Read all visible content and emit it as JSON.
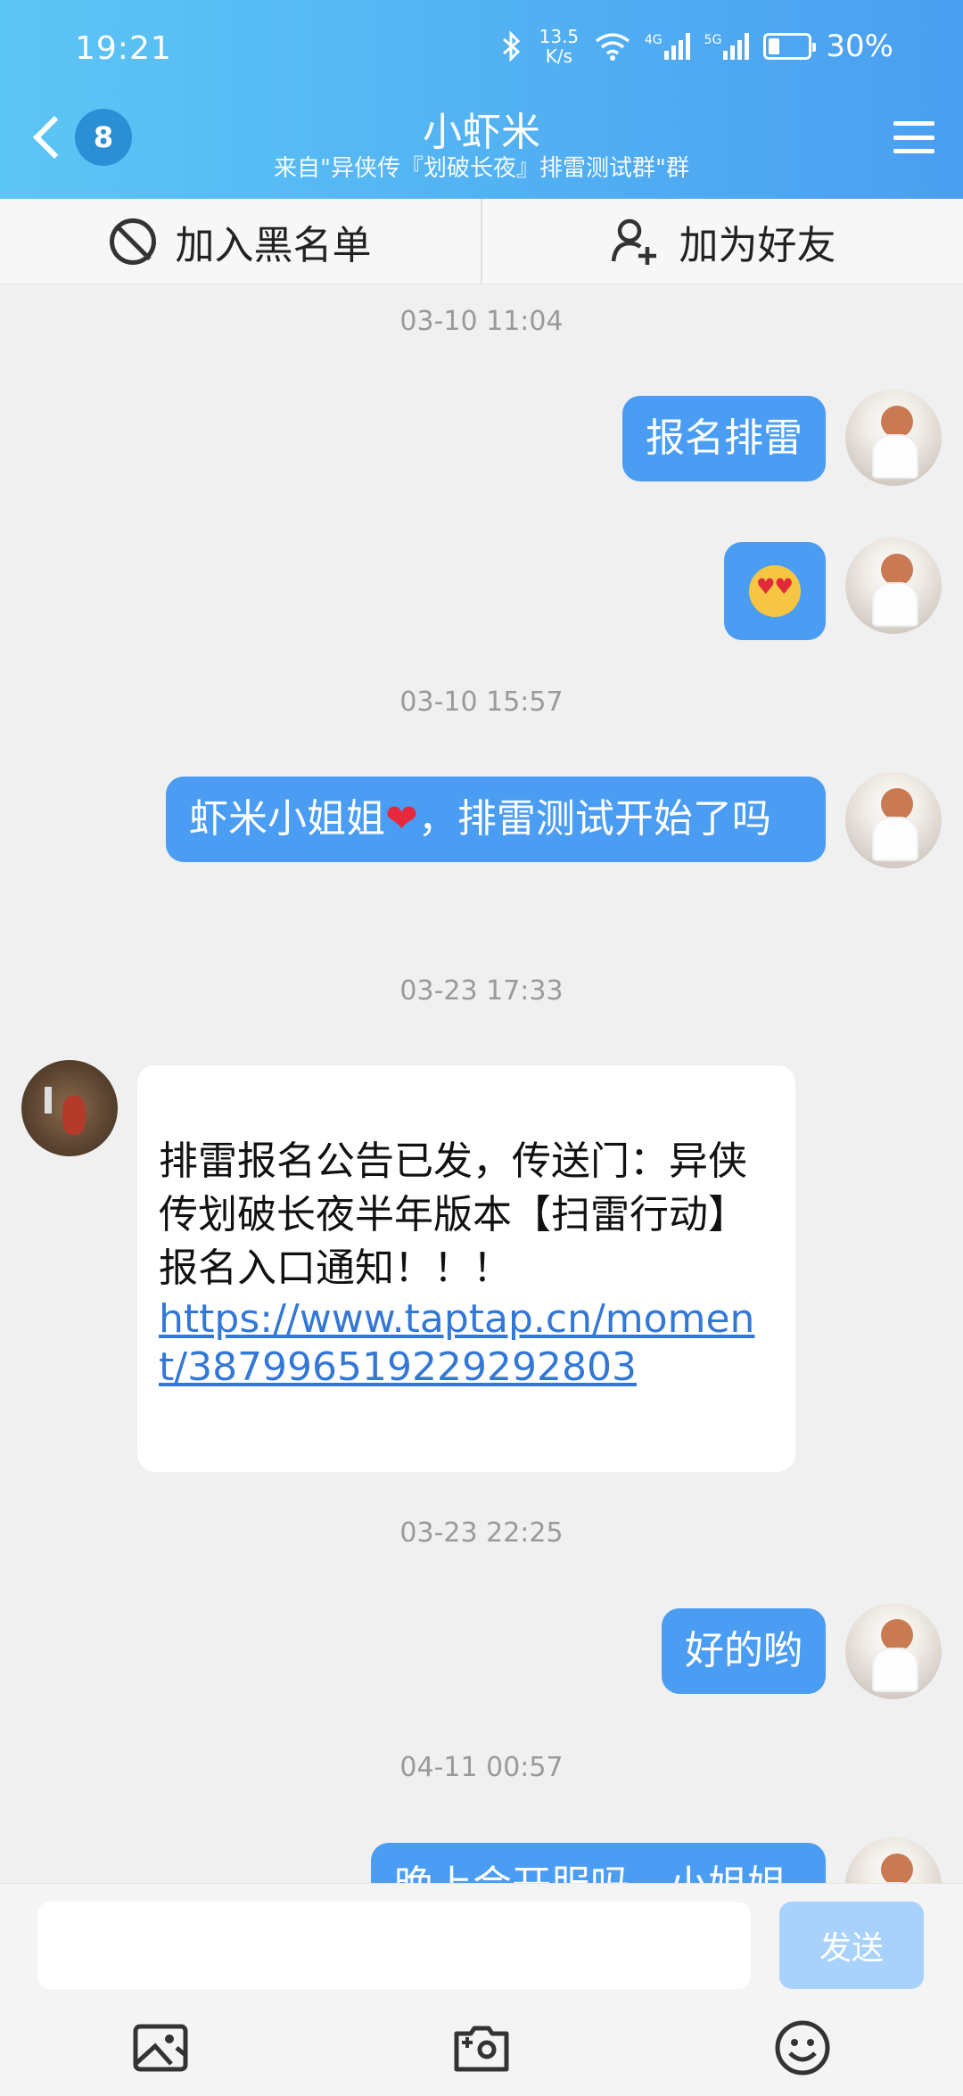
{
  "status_bar": {
    "time": "19:21",
    "speed_value": "13.5",
    "speed_unit": "K/s",
    "net_4g": "4G",
    "net_5g": "5G",
    "battery": "30%"
  },
  "header": {
    "unread_count": "8",
    "title": "小虾米",
    "subtitle": "来自\"异侠传『划破长夜』排雷测试群\"群"
  },
  "actions": {
    "blacklist": "加入黑名单",
    "add_friend": "加为好友"
  },
  "messages": {
    "ts1": "03-10 11:04",
    "m1": "报名排雷",
    "ts2": "03-10 15:57",
    "m3_before": "虾米小姐姐",
    "m3_after": "，排雷测试开始了吗",
    "ts3": "03-23 17:33",
    "m4_text": "排雷报名公告已发，传送门：异侠传划破长夜半年版本【扫雷行动】报名入口通知！！！",
    "m4_link": "https://www.taptap.cn/moment/387996519229292803",
    "ts4": "03-23 22:25",
    "m5": "好的哟",
    "ts5": "04-11 00:57",
    "m6": "晚上会开服吗，小姐姐"
  },
  "input": {
    "placeholder": "",
    "send_label": "发送"
  },
  "icons": {
    "image": "image-icon",
    "camera": "camera-icon",
    "emoji": "emoji-icon"
  },
  "colors": {
    "header_start": "#5cc6f5",
    "header_end": "#4a9ff0",
    "bubble_me": "#4a9df2",
    "link": "#3478d6",
    "send_disabled": "#a8d2fb"
  }
}
